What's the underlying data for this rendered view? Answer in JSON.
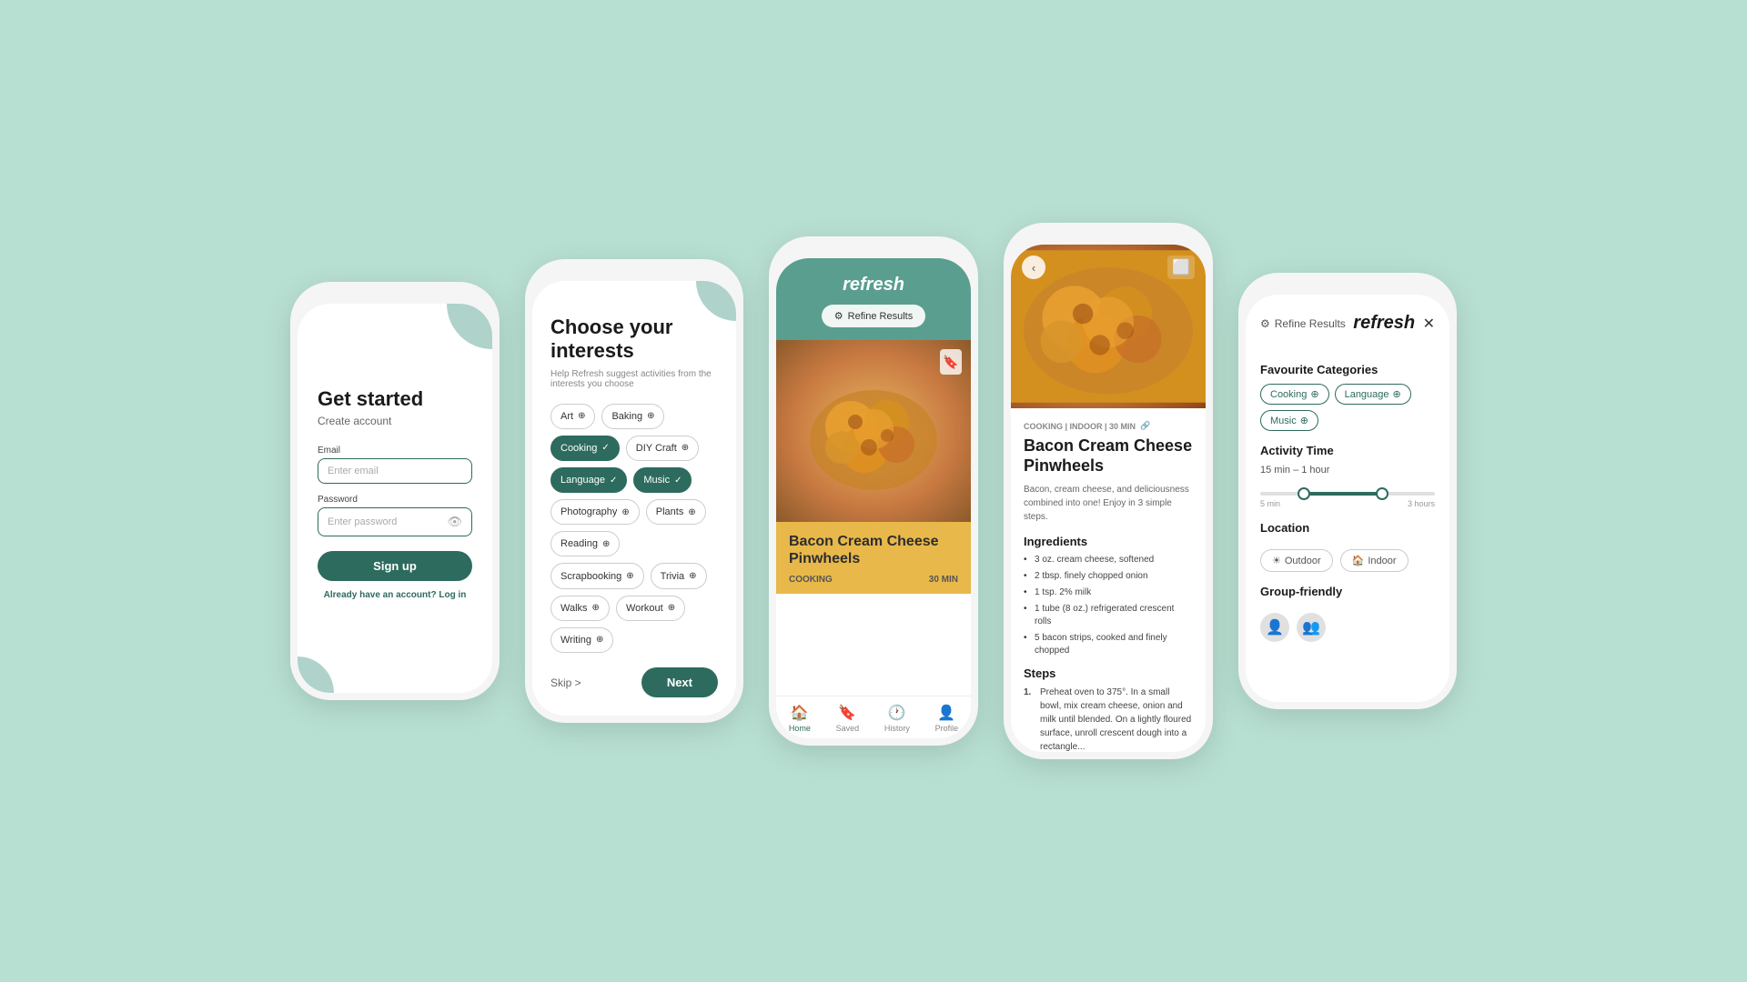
{
  "bg_color": "#b8e0d2",
  "screens": {
    "screen1": {
      "title": "Get started",
      "subtitle": "Create account",
      "email_label": "Email",
      "email_placeholder": "Enter email",
      "password_label": "Password",
      "password_placeholder": "Enter password",
      "sign_up_btn": "Sign up",
      "login_text": "Already have an account?",
      "login_link": "Log in"
    },
    "screen2": {
      "title": "Choose your interests",
      "description": "Help Refresh suggest activities from the interests you choose",
      "tags": [
        {
          "label": "Art",
          "selected": false
        },
        {
          "label": "Baking",
          "selected": false
        },
        {
          "label": "Cooking",
          "selected": true
        },
        {
          "label": "DIY Craft",
          "selected": false
        },
        {
          "label": "Language",
          "selected": true
        },
        {
          "label": "Music",
          "selected": true
        },
        {
          "label": "Photography",
          "selected": false
        },
        {
          "label": "Plants",
          "selected": false
        },
        {
          "label": "Reading",
          "selected": false
        },
        {
          "label": "Scrapbooking",
          "selected": false
        },
        {
          "label": "Trivia",
          "selected": false
        },
        {
          "label": "Walks",
          "selected": false
        },
        {
          "label": "Workout",
          "selected": false
        },
        {
          "label": "Writing",
          "selected": false
        }
      ],
      "skip_label": "Skip >",
      "next_label": "Next"
    },
    "screen3": {
      "app_title": "refresh",
      "refine_btn": "Refine Results",
      "card_title": "Bacon Cream Cheese Pinwheels",
      "card_category": "COOKING",
      "card_time": "30 MIN",
      "nav_items": [
        {
          "label": "Home",
          "icon": "🏠",
          "active": true
        },
        {
          "label": "Saved",
          "icon": "🔖",
          "active": false
        },
        {
          "label": "History",
          "icon": "🕐",
          "active": false
        },
        {
          "label": "Profile",
          "icon": "👤",
          "active": false
        }
      ]
    },
    "screen4": {
      "tags_line": "COOKING | INDOOR | 30 MIN",
      "recipe_title": "Bacon Cream Cheese Pinwheels",
      "description": "Bacon, cream cheese, and deliciousness combined into one! Enjoy in 3 simple steps.",
      "ingredients_title": "Ingredients",
      "ingredients": [
        "3 oz. cream cheese, softened",
        "2 tbsp. finely chopped onion",
        "1 tsp. 2% milk",
        "1 tube (8 oz.) refrigerated crescent rolls",
        "5 bacon strips, cooked and finely chopped"
      ],
      "steps_title": "Steps",
      "steps": [
        "Preheat oven to 375°. In a small bowl, mix cream cheese, onion and milk until blended. On a lightly floured surface, unroll crescent dough into a rectangle..."
      ]
    },
    "screen5": {
      "app_title": "refresh",
      "refine_label": "Refine Results",
      "close_icon": "✕",
      "fav_categories_title": "Favourite Categories",
      "fav_tags": [
        {
          "label": "Cooking",
          "selected": true
        },
        {
          "label": "Language",
          "selected": true
        },
        {
          "label": "Music",
          "selected": true
        }
      ],
      "activity_time_title": "Activity Time",
      "time_range_label": "15 min – 1 hour",
      "time_min": "5 min",
      "time_max": "3 hours",
      "location_title": "Location",
      "location_options": [
        "Outdoor",
        "Indoor"
      ],
      "group_friendly_title": "Group-friendly"
    }
  }
}
